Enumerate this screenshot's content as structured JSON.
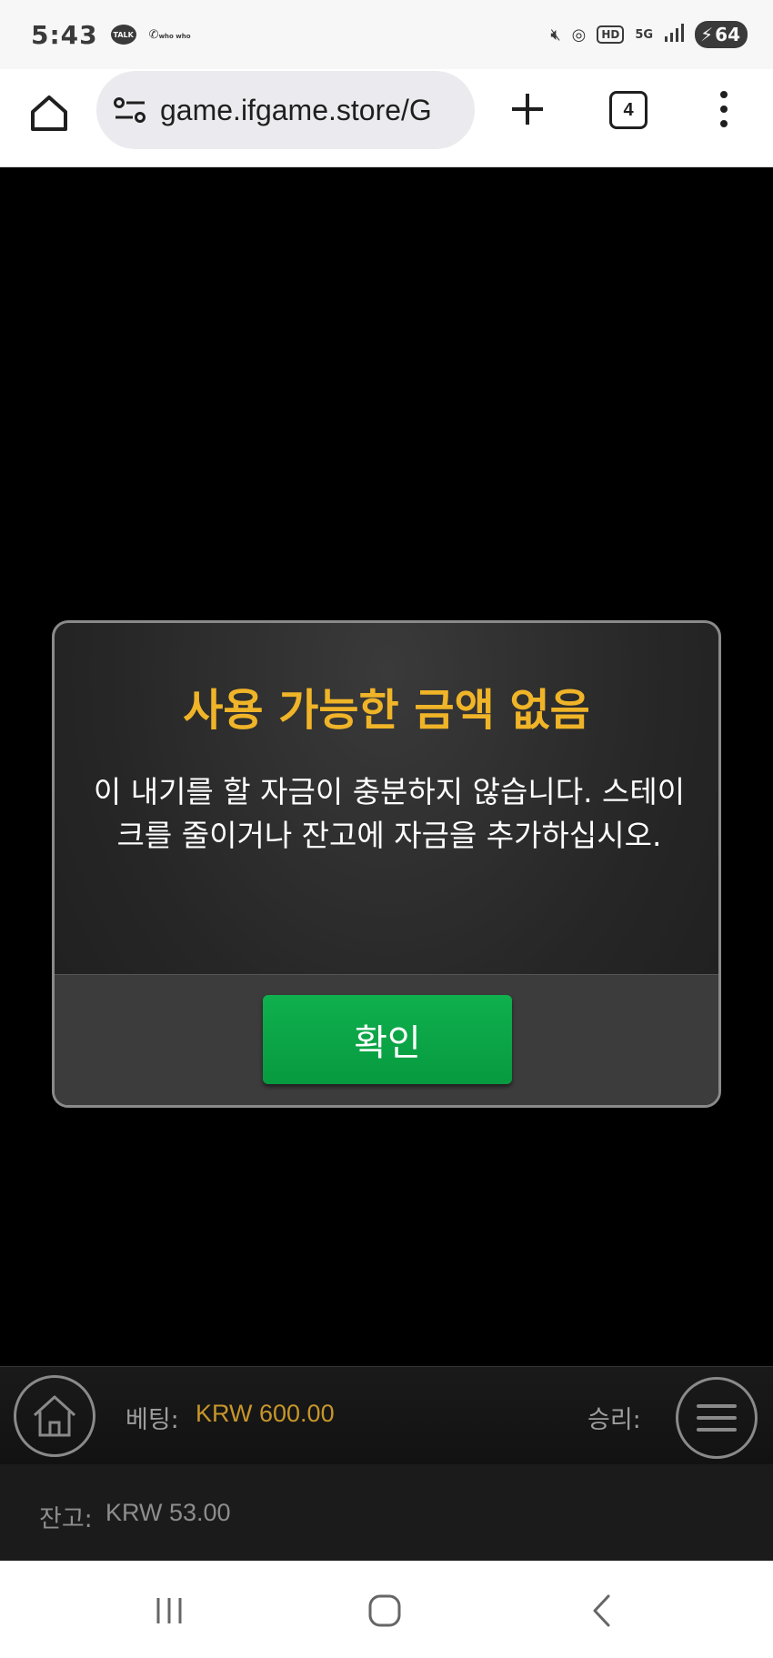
{
  "status_bar": {
    "time": "5:43",
    "talk_label": "TALK",
    "who_label": "who who",
    "network": "5G",
    "hd": "HD",
    "battery": "64"
  },
  "browser": {
    "url": "game.ifgame.store/G",
    "tab_count": "4"
  },
  "dialog": {
    "title": "사용 가능한 금액 없음",
    "message": "이 내기를 할 자금이 충분하지 않습니다. 스테이크를 줄이거나 잔고에 자금을 추가하십시오.",
    "ok_label": "확인"
  },
  "game_bar": {
    "bet_label": "베팅:",
    "bet_value": "KRW 600.00",
    "win_label": "승리:"
  },
  "balance": {
    "label": "잔고:",
    "value": "KRW 53.00"
  },
  "colors": {
    "title": "#f0b428",
    "ok_button": "#0aa548",
    "bet_value": "#c7962a"
  }
}
